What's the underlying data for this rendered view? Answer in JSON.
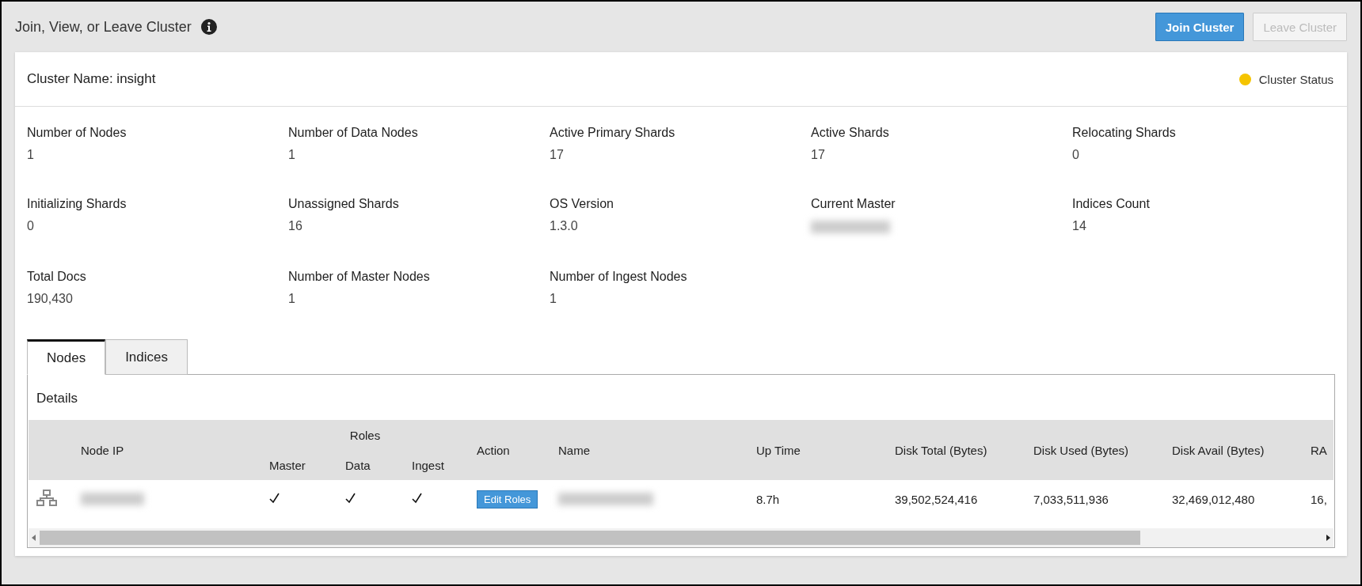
{
  "header": {
    "title": "Join, View, or Leave Cluster"
  },
  "buttons": [
    {
      "label": "Join Cluster",
      "kind": "primary",
      "disabled": false
    },
    {
      "label": "Leave Cluster",
      "kind": "secondary",
      "disabled": true
    }
  ],
  "cluster": {
    "name_label": "Cluster Name: insight",
    "status": {
      "label": "Cluster Status",
      "color": "#f5c400"
    }
  },
  "stats": [
    {
      "label": "Number of Nodes",
      "value": "1"
    },
    {
      "label": "Number of Data Nodes",
      "value": "1"
    },
    {
      "label": "Active Primary Shards",
      "value": "17"
    },
    {
      "label": "Active Shards",
      "value": "17"
    },
    {
      "label": "Relocating Shards",
      "value": "0"
    },
    {
      "label": "Initializing Shards",
      "value": "0"
    },
    {
      "label": "Unassigned Shards",
      "value": "16"
    },
    {
      "label": "OS Version",
      "value": "1.3.0"
    },
    {
      "label": "Current Master",
      "redacted": true
    },
    {
      "label": "Indices Count",
      "value": "14"
    },
    {
      "label": "Total Docs",
      "value": "190,430"
    },
    {
      "label": "Number of Master Nodes",
      "value": "1"
    },
    {
      "label": "Number of Ingest Nodes",
      "value": "1"
    }
  ],
  "tabs": [
    {
      "label": "Nodes",
      "selected": true
    },
    {
      "label": "Indices",
      "selected": false
    }
  ],
  "details": {
    "title": "Details",
    "group_header": "Roles",
    "columns": [
      "Node IP",
      "Master",
      "Data",
      "Ingest",
      "Action",
      "Name",
      "Up Time",
      "Disk Total (Bytes)",
      "Disk Used (Bytes)",
      "Disk Avail (Bytes)",
      "RA"
    ],
    "rows": [
      {
        "master": true,
        "data": true,
        "ingest": true,
        "action": "Edit Roles",
        "up_time": "8.7h",
        "disk_total": "39,502,524,416",
        "disk_used": "7,033,511,936",
        "disk_avail": "32,469,012,480",
        "column_11": "16,"
      }
    ]
  }
}
